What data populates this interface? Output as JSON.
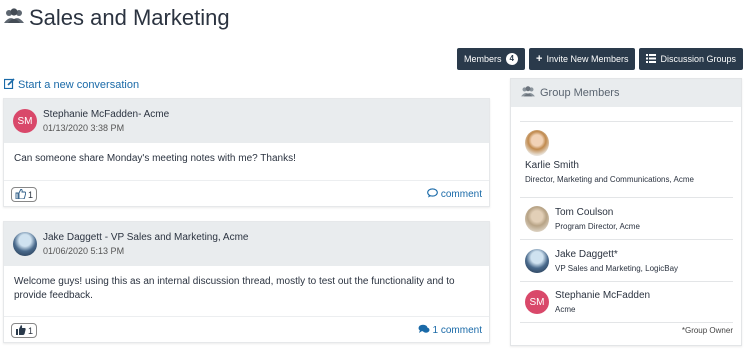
{
  "page": {
    "title": "Sales and Marketing"
  },
  "toolbar": {
    "members_label": "Members",
    "members_count": "4",
    "invite_label": "Invite New Members",
    "groups_label": "Discussion Groups"
  },
  "start_conversation": "Start a new conversation",
  "posts": [
    {
      "author": "Stephanie McFadden- Acme",
      "initials": "SM",
      "date": "01/13/2020 3:38 PM",
      "body": "Can someone share Monday's meeting notes with me? Thanks!",
      "likes": "1",
      "comment_label": "comment"
    },
    {
      "author": "Jake Daggett - VP Sales and Marketing, Acme",
      "date": "01/06/2020 5:13 PM",
      "body": "Welcome guys! using this as an internal discussion thread, mostly to test out the functionality and to provide feedback.",
      "likes": "1",
      "comment_label": "1 comment"
    }
  ],
  "members_panel": {
    "title": "Group Members",
    "members": [
      {
        "name": "Karlie Smith",
        "role": "Director, Marketing and Communications, Acme"
      },
      {
        "name": "Tom Coulson",
        "role": "Program Director, Acme"
      },
      {
        "name": "Jake Daggett*",
        "role": "VP Sales and Marketing, LogicBay"
      },
      {
        "name": "Stephanie McFadden",
        "role": "Acme",
        "initials": "SM"
      }
    ],
    "owner_note": "*Group Owner"
  },
  "colors": {
    "button_bg": "#2a3a4b",
    "link": "#1a6aa8",
    "avatar_sm": "#d9486a",
    "header_bg": "#e9ecee"
  }
}
